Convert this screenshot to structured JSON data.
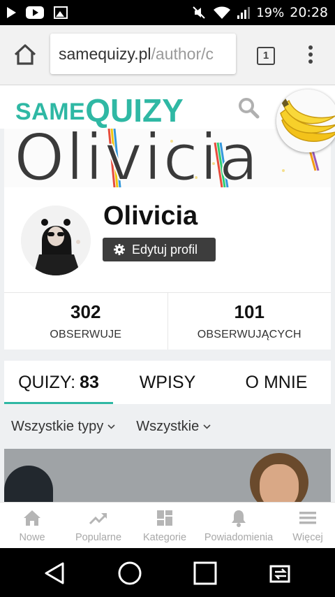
{
  "status_bar": {
    "battery": "19%",
    "time": "20:28"
  },
  "browser": {
    "url_domain": "samequizy.pl",
    "url_path": "/author/c",
    "tab_count": "1"
  },
  "site": {
    "logo_small": "SAME",
    "logo_big": "QUIZY",
    "brand_color": "#2fb8a4"
  },
  "banner": {
    "text": "Olivicia"
  },
  "profile": {
    "name": "Olivicia",
    "edit_label": "Edytuj profil"
  },
  "stats": [
    {
      "value": "302",
      "label": "OBSERWUJE"
    },
    {
      "value": "101",
      "label": "OBSERWUJĄCYCH"
    }
  ],
  "tabs": [
    {
      "label": "QUIZY:",
      "count": "83",
      "active": true
    },
    {
      "label": "WPISY"
    },
    {
      "label": "O MNIE"
    }
  ],
  "filters": [
    {
      "label": "Wszystkie typy"
    },
    {
      "label": "Wszystkie"
    }
  ],
  "bottom_nav": [
    {
      "label": "Nowe",
      "icon": "home-icon"
    },
    {
      "label": "Popularne",
      "icon": "trending-icon"
    },
    {
      "label": "Kategorie",
      "icon": "grid-icon"
    },
    {
      "label": "Powiadomienia",
      "icon": "bell-icon"
    },
    {
      "label": "Więcej",
      "icon": "menu-icon"
    }
  ]
}
